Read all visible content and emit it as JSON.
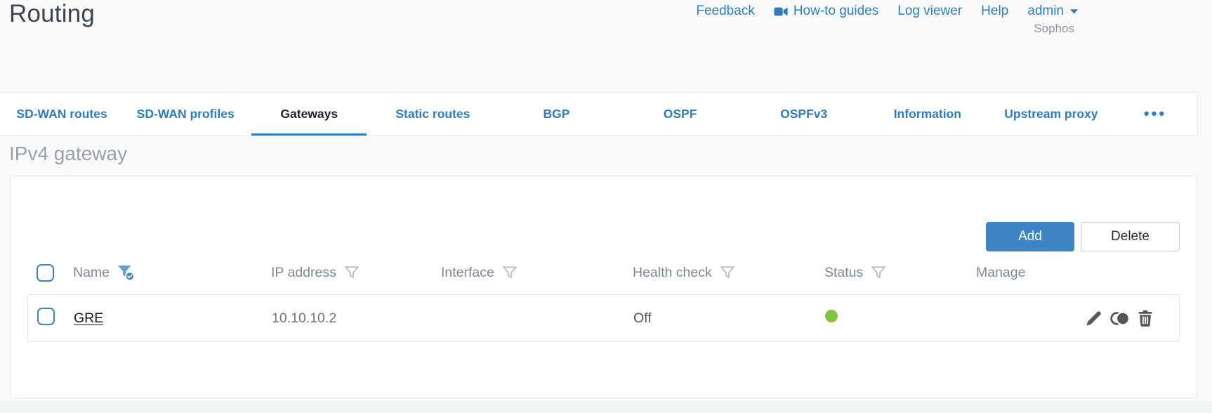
{
  "header": {
    "title": "Routing",
    "brand": "Sophos",
    "nav": {
      "feedback": "Feedback",
      "howto_guides": "How-to guides",
      "log_viewer": "Log viewer",
      "help": "Help",
      "user": "admin"
    }
  },
  "tabs": {
    "items": [
      {
        "label": "SD-WAN routes"
      },
      {
        "label": "SD-WAN profiles"
      },
      {
        "label": "Gateways"
      },
      {
        "label": "Static routes"
      },
      {
        "label": "BGP"
      },
      {
        "label": "OSPF"
      },
      {
        "label": "OSPFv3"
      },
      {
        "label": "Information"
      },
      {
        "label": "Upstream proxy"
      }
    ],
    "active": "Gateways",
    "more": "•••"
  },
  "section": {
    "title": "IPv4 gateway"
  },
  "toolbar": {
    "add": "Add",
    "delete": "Delete"
  },
  "table": {
    "columns": {
      "name": "Name",
      "ip": "IP address",
      "interface": "Interface",
      "health": "Health check",
      "status": "Status",
      "manage": "Manage"
    },
    "filter_states": {
      "name": "active",
      "ip": "inactive",
      "interface": "inactive",
      "health": "inactive",
      "status": "inactive"
    },
    "rows": [
      {
        "name": "GRE",
        "ip": "10.10.10.2",
        "interface": "",
        "health": "Off",
        "status": "green",
        "status_style": "background:#84c341"
      }
    ]
  },
  "icons": {
    "howto": "video-camera-icon",
    "user_caret": "caret-down-icon",
    "name_filter": "funnel-check-icon",
    "column_filter": "funnel-icon",
    "manage": [
      "edit-pencil-icon",
      "clone-icon",
      "trash-icon"
    ]
  },
  "colors": {
    "link_blue": "#2e7cc0",
    "button_blue": "#3d85c5",
    "status_green": "#84c341",
    "active_tab_text": "#1d2228"
  }
}
